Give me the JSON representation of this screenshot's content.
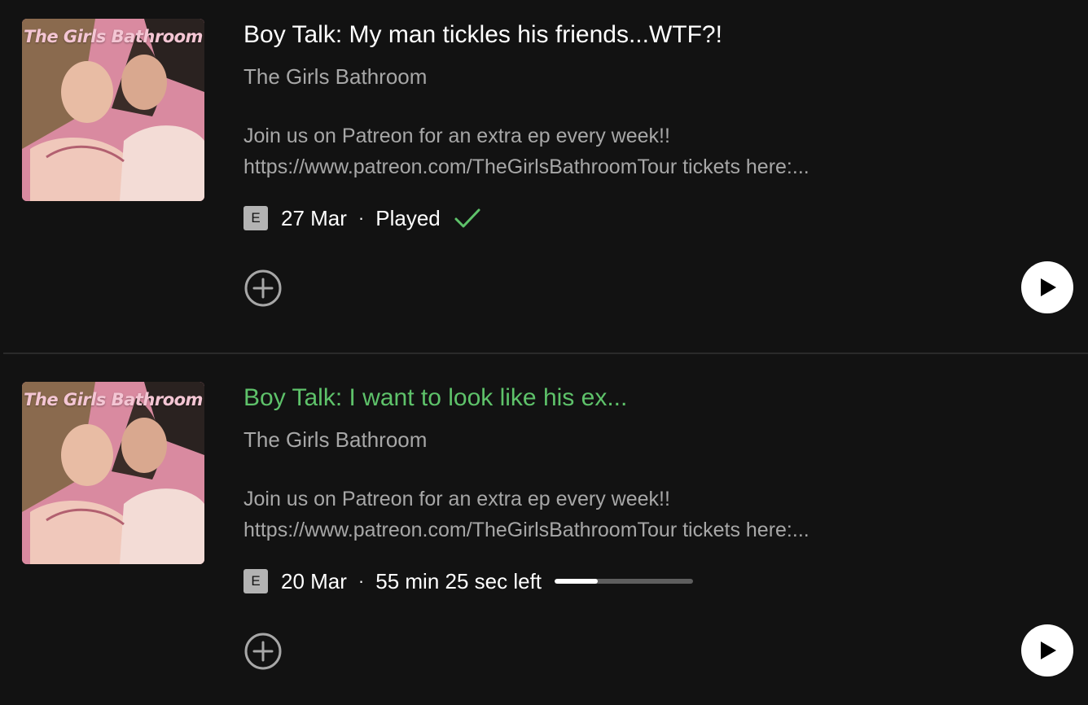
{
  "episodes": [
    {
      "cover_title": "The Girls Bathroom",
      "title": "Boy Talk: My man tickles his friends...WTF?!",
      "show": "The Girls Bathroom",
      "description_line1": "Join us on Patreon for an extra ep every week!!",
      "description_line2": "https://www.patreon.com/TheGirlsBathroomTour tickets here:...",
      "explicit_badge": "E",
      "date": "27 Mar",
      "separator": "·",
      "status": "Played",
      "status_icon": "check-icon",
      "active": false
    },
    {
      "cover_title": "The Girls Bathroom",
      "title": "Boy Talk: I want to look like his ex...",
      "show": "The Girls Bathroom",
      "description_line1": "Join us on Patreon for an extra ep every week!!",
      "description_line2": "https://www.patreon.com/TheGirlsBathroomTour tickets here:...",
      "explicit_badge": "E",
      "date": "20 Mar",
      "separator": "·",
      "status": "55 min 25 sec left",
      "progress_fraction": 0.31,
      "active": true
    }
  ],
  "icons": {
    "add": "add-circle-icon",
    "play": "play-icon",
    "check": "check-icon"
  },
  "colors": {
    "background": "#121212",
    "accent_green": "#5ec26a",
    "secondary_text": "#a7a7a7",
    "cover_pink": "#d98aa0"
  }
}
